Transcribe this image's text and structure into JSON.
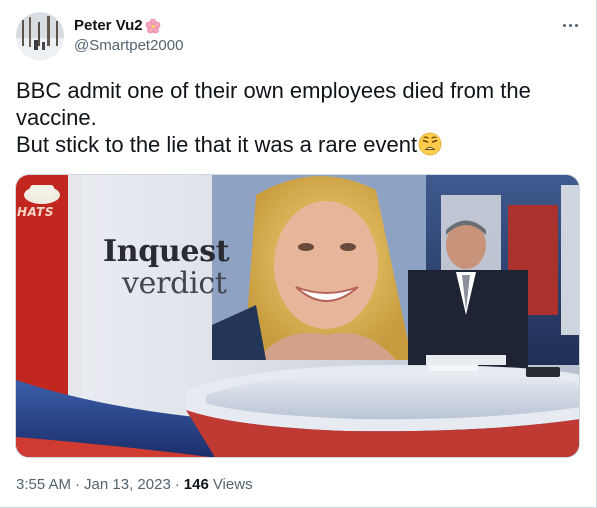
{
  "tweet": {
    "author": {
      "display_name": "Peter Vu2",
      "display_name_emoji": "cherry-blossom",
      "handle": "@Smartpet2000"
    },
    "text_lines": [
      "BBC admit one of their own employees died from the",
      "vaccine.",
      "But stick to the lie that it was a rare event"
    ],
    "text_trailing_emoji": "weary-face",
    "media": {
      "overlay_title": "Inquest",
      "overlay_subtitle": "verdict",
      "channel_logo_text": "HATS"
    },
    "meta": {
      "time": "3:55 AM",
      "separator": "·",
      "date": "Jan 13, 2023",
      "views_count": "146",
      "views_label": "Views"
    }
  },
  "colors": {
    "text_primary": "#0f1419",
    "text_secondary": "#536471",
    "border": "#cfd9de"
  }
}
